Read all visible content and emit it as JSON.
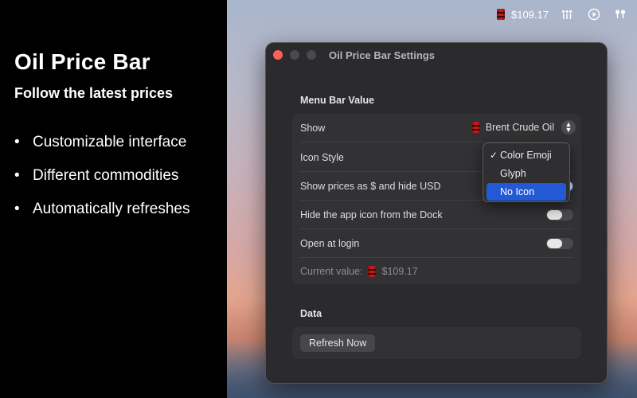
{
  "promo": {
    "title": "Oil Price Bar",
    "subtitle": "Follow the latest prices",
    "features": [
      "Customizable interface",
      "Different commodities",
      "Automatically refreshes"
    ]
  },
  "menubar": {
    "price": "$109.17",
    "icons": [
      "oil-barrel-icon",
      "wifi-bars-icon",
      "play-circle-icon",
      "airpods-icon"
    ]
  },
  "window": {
    "title": "Oil Price Bar Settings",
    "menu_bar_section": {
      "header": "Menu Bar Value",
      "show": {
        "label": "Show",
        "value": "Brent Crude Oil"
      },
      "icon_style": {
        "label": "Icon Style"
      },
      "show_dollar": {
        "label": "Show prices as $ and hide USD",
        "on": true
      },
      "hide_dock": {
        "label": "Hide the app icon from the Dock",
        "on": false
      },
      "open_login": {
        "label": "Open at login",
        "on": false
      },
      "current_value_label": "Current value:",
      "current_value": "$109.17"
    },
    "data_section": {
      "header": "Data",
      "refresh_label": "Refresh Now"
    }
  },
  "icon_style_menu": {
    "options": [
      "Color Emoji",
      "Glyph",
      "No Icon"
    ],
    "checked": "Color Emoji",
    "highlighted": "No Icon"
  },
  "colors": {
    "accent": "#2459d6",
    "close": "#ff5f57",
    "barrel": "#d02020"
  }
}
